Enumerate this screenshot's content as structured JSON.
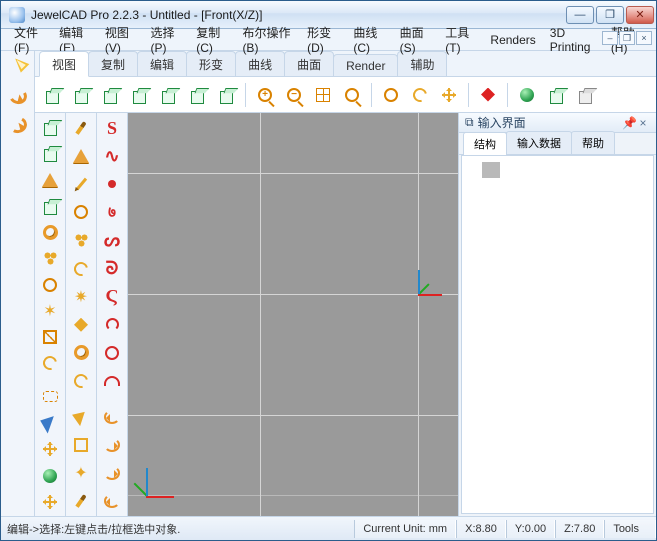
{
  "title": "JewelCAD Pro 2.2.3 - Untitled - [Front(X/Z)]",
  "menus": {
    "file": "文件(F)",
    "edit": "编辑(E)",
    "view": "视图(V)",
    "select": "选择(P)",
    "copy": "复制(C)",
    "boolean": "布尔操作(B)",
    "deform": "形变(D)",
    "curve": "曲线(C)",
    "surface": "曲面(S)",
    "tools": "工具(T)",
    "renders": "Renders",
    "printing": "3D Printing",
    "help": "帮助(H)"
  },
  "mdi": {
    "min": "–",
    "restore": "❐",
    "close": "×"
  },
  "tabs": {
    "view": "视图",
    "copy": "复制",
    "edit": "编辑",
    "deform": "形变",
    "curve": "曲线",
    "surface": "曲面",
    "render": "Render",
    "helpers": "辅助"
  },
  "dock": {
    "title": "输入界面",
    "pin_glyph": "�留",
    "close_glyph": "×",
    "tab_struct": "结构",
    "tab_input": "输入数据",
    "tab_help": "帮助"
  },
  "status": {
    "message": "编辑->选择:左键点击/拉框选中对象.",
    "unit": "Current Unit:   mm",
    "x": "X:8.80",
    "y": "Y:0.00",
    "z": "Z:7.80",
    "tools": "Tools"
  },
  "win": {
    "min": "—",
    "max": "❐",
    "close": "✕"
  }
}
